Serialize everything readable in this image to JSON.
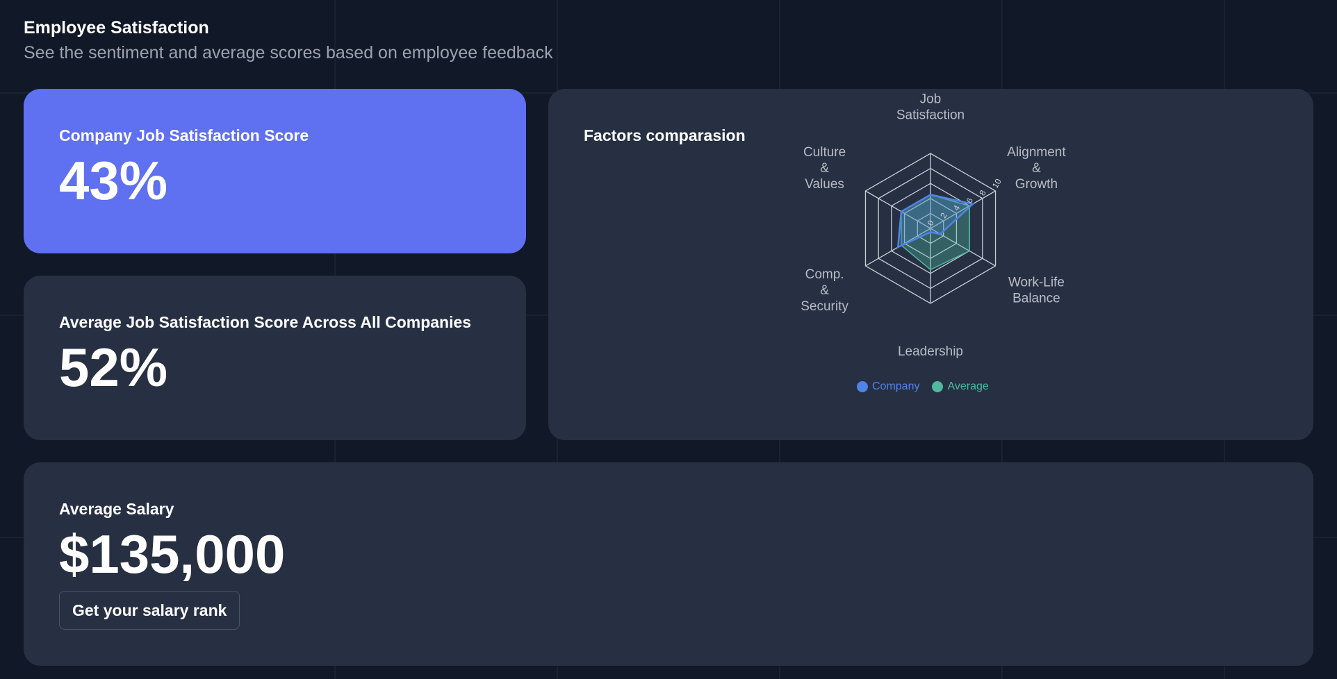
{
  "header": {
    "title": "Employee Satisfaction",
    "subtitle": "See the sentiment and average scores based on employee feedback"
  },
  "company_card": {
    "label": "Company Job Satisfaction Score",
    "value": "43%"
  },
  "average_card": {
    "label": "Average Job Satisfaction Score Across All Companies",
    "value": "52%"
  },
  "salary_card": {
    "label": "Average Salary",
    "value": "$135,000",
    "button_label": "Get your salary rank"
  },
  "factors_card": {
    "label": "Factors comparasion"
  },
  "colors": {
    "page_background": "#111827",
    "card_background": "#273043",
    "accent_card": "#5f70f0",
    "company_series": "#4f84e8",
    "average_series": "#4fb9a1"
  },
  "chart_data": {
    "type": "radar",
    "axes": [
      [
        "Job",
        "Satisfaction"
      ],
      [
        "Alignment",
        "&",
        "Growth"
      ],
      [
        "Work-Life",
        "Balance"
      ],
      [
        "Leadership"
      ],
      [
        "Comp.",
        "&",
        "Security"
      ],
      [
        "Culture",
        "&",
        "Values"
      ]
    ],
    "range": [
      0,
      10
    ],
    "ticks": [
      "0",
      "2",
      "4",
      "6",
      "8",
      "10"
    ],
    "series": [
      {
        "name": "Company",
        "values": [
          4.5,
          6.5,
          1.5,
          0.5,
          5,
          4.5
        ]
      },
      {
        "name": "Average",
        "values": [
          4.5,
          6.0,
          6.0,
          5.5,
          4.5,
          4.5
        ]
      }
    ],
    "legend": "bottom"
  }
}
